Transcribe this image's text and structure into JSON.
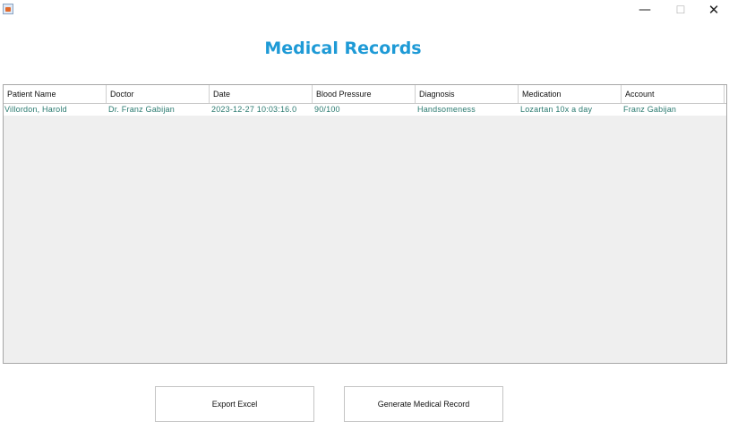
{
  "window": {
    "minimize_glyph": "—",
    "maximize_glyph": "☐",
    "close_glyph": "✕"
  },
  "page": {
    "title": "Medical Records"
  },
  "table": {
    "columns": [
      "Patient Name",
      "Doctor",
      "Date",
      "Blood Pressure",
      "Diagnosis",
      "Medication",
      "Account"
    ],
    "rows": [
      [
        "Villordon, Harold",
        "Dr. Franz Gabijan",
        "2023-12-27 10:03:16.0",
        "90/100",
        "Handsomeness",
        "Lozartan 10x a day",
        "Franz Gabijan"
      ]
    ]
  },
  "actions": {
    "export_label": "Export Excel",
    "generate_label": "Generate Medical Record"
  },
  "colors": {
    "title": "#1e9ad6",
    "row_text": "#2a7a70"
  }
}
